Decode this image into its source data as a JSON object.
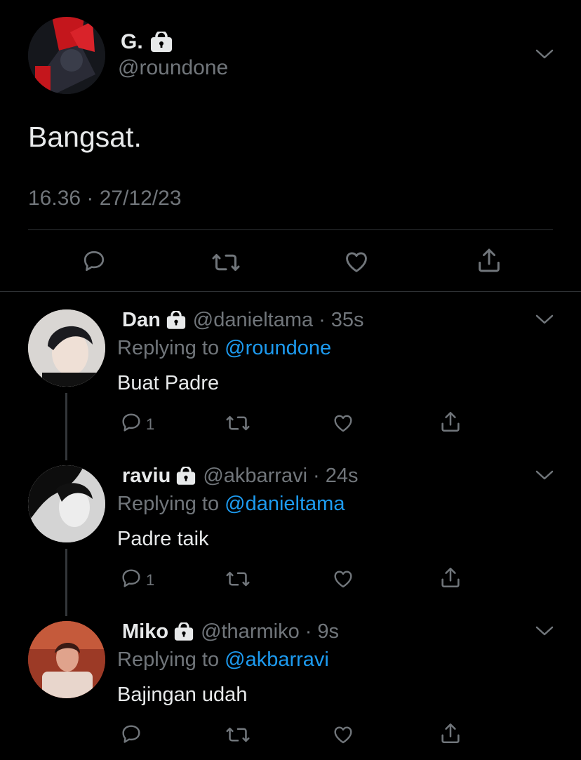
{
  "main_tweet": {
    "display_name": "G.",
    "handle": "@roundone",
    "text": "Bangsat.",
    "meta": "16.36 · 27/12/23",
    "avatar_icon": "user-avatar"
  },
  "actions": {
    "reply_icon": "reply-icon",
    "retweet_icon": "retweet-icon",
    "like_icon": "heart-icon",
    "share_icon": "share-icon"
  },
  "replies": [
    {
      "display_name": "Dan",
      "handle": "@danieltama",
      "time": "35s",
      "replying_prefix": "Replying to",
      "replying_to": "@roundone",
      "text": "Buat Padre",
      "reply_count": "1"
    },
    {
      "display_name": "raviu",
      "handle": "@akbarravi",
      "time": "24s",
      "replying_prefix": "Replying to",
      "replying_to": "@danieltama",
      "text": "Padre taik",
      "reply_count": "1"
    },
    {
      "display_name": "Miko",
      "handle": "@tharmiko",
      "time": "9s",
      "replying_prefix": "Replying to",
      "replying_to": "@akbarravi",
      "text": "Bajingan udah",
      "reply_count": ""
    }
  ],
  "colors": {
    "background": "#000000",
    "text": "#e7e9ea",
    "secondary": "#71767b",
    "link": "#1d9bf0",
    "divider": "#2f3336"
  }
}
